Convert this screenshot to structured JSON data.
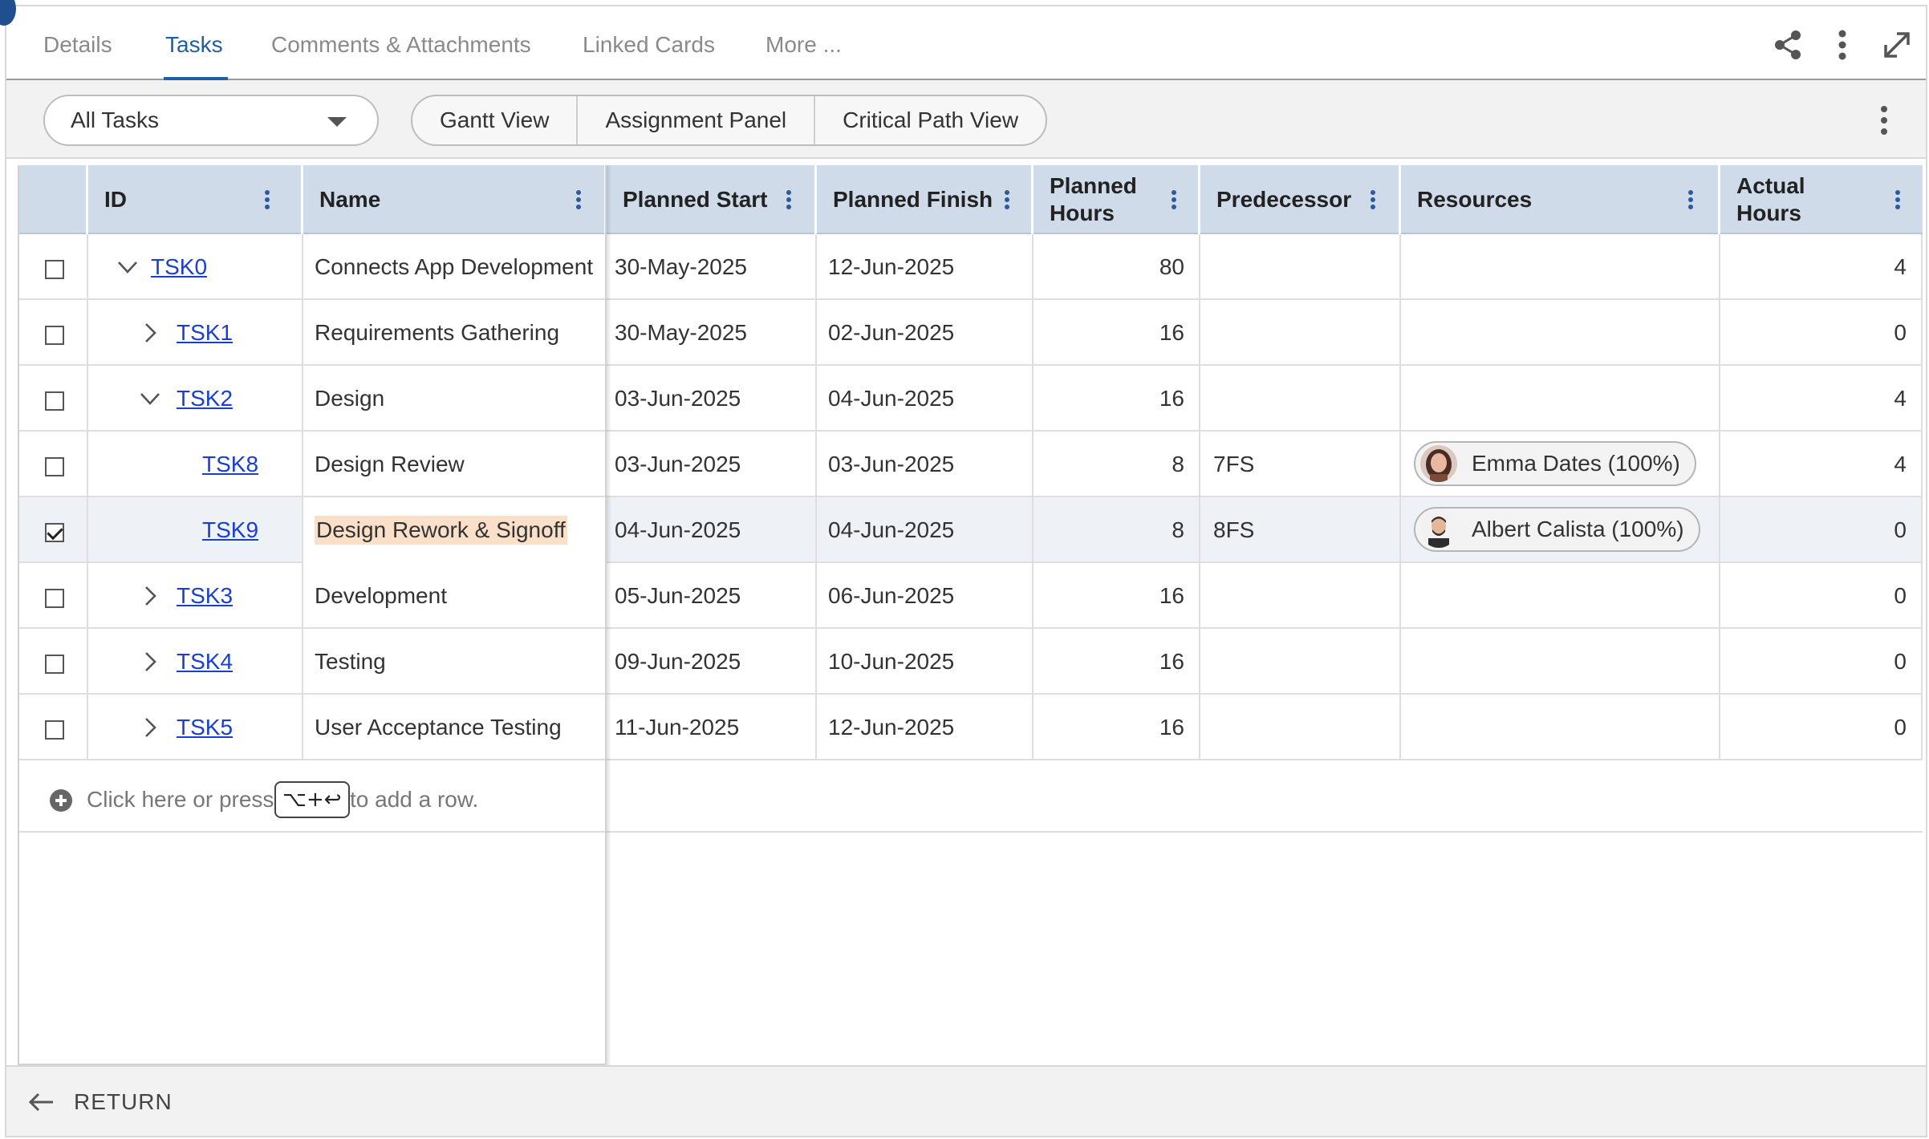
{
  "tabs": [
    {
      "label": "Details",
      "active": false
    },
    {
      "label": "Tasks",
      "active": true
    },
    {
      "label": "Comments & Attachments",
      "active": false
    },
    {
      "label": "Linked Cards",
      "active": false
    },
    {
      "label": "More ...",
      "active": false
    }
  ],
  "top_icons": [
    "share-icon",
    "more-vertical-icon",
    "expand-icon"
  ],
  "toolbar": {
    "filter_value": "All Tasks",
    "views": [
      "Gantt View",
      "Assignment Panel",
      "Critical Path View"
    ]
  },
  "columns": {
    "id": "ID",
    "name": "Name",
    "planned_start": "Planned Start",
    "planned_finish": "Planned Finish",
    "planned_hours": [
      "Planned",
      "Hours"
    ],
    "predecessor": "Predecessor",
    "resources": "Resources",
    "actual_hours": [
      "Actual",
      "Hours"
    ]
  },
  "rows": [
    {
      "checked": false,
      "expander": "expanded",
      "id": "TSK0",
      "name": "Connects App Development",
      "planned_start": "30-May-2025",
      "planned_finish": "12-Jun-2025",
      "planned_hours": "80",
      "predecessor": "",
      "resource": "",
      "actual_hours": "4"
    },
    {
      "checked": false,
      "expander": "collapsed",
      "id": "TSK1",
      "name": "Requirements Gathering",
      "planned_start": "30-May-2025",
      "planned_finish": "02-Jun-2025",
      "planned_hours": "16",
      "predecessor": "",
      "resource": "",
      "actual_hours": "0"
    },
    {
      "checked": false,
      "expander": "expanded",
      "id": "TSK2",
      "name": "Design",
      "planned_start": "03-Jun-2025",
      "planned_finish": "04-Jun-2025",
      "planned_hours": "16",
      "predecessor": "",
      "resource": "",
      "actual_hours": "4"
    },
    {
      "checked": false,
      "expander": "none",
      "id": "TSK8",
      "name": "Design Review",
      "planned_start": "03-Jun-2025",
      "planned_finish": "03-Jun-2025",
      "planned_hours": "8",
      "predecessor": "7FS",
      "resource": "Emma Dates (100%)",
      "actual_hours": "4"
    },
    {
      "checked": true,
      "expander": "none",
      "id": "TSK9",
      "name": "Design Rework & Signoff",
      "planned_start": "04-Jun-2025",
      "planned_finish": "04-Jun-2025",
      "planned_hours": "8",
      "predecessor": "8FS",
      "resource": "Albert Calista (100%)",
      "actual_hours": "0"
    },
    {
      "checked": false,
      "expander": "collapsed",
      "id": "TSK3",
      "name": "Development",
      "planned_start": "05-Jun-2025",
      "planned_finish": "06-Jun-2025",
      "planned_hours": "16",
      "predecessor": "",
      "resource": "",
      "actual_hours": "0"
    },
    {
      "checked": false,
      "expander": "collapsed",
      "id": "TSK4",
      "name": "Testing",
      "planned_start": "09-Jun-2025",
      "planned_finish": "10-Jun-2025",
      "planned_hours": "16",
      "predecessor": "",
      "resource": "",
      "actual_hours": "0"
    },
    {
      "checked": false,
      "expander": "collapsed",
      "id": "TSK5",
      "name": "User Acceptance Testing",
      "planned_start": "11-Jun-2025",
      "planned_finish": "12-Jun-2025",
      "planned_hours": "16",
      "predecessor": "",
      "resource": "",
      "actual_hours": "0"
    }
  ],
  "add_row": {
    "prefix": "Click here or press",
    "shortcut": "⌥+↩",
    "suffix": "to add a row."
  },
  "footer": {
    "return_label": "RETURN"
  },
  "colors": {
    "accent": "#1f5fa8",
    "header_bg": "#cfdbe9",
    "link": "#1a3fd0",
    "highlight": "#fbe0c9",
    "selected_row": "#eef1f6"
  }
}
